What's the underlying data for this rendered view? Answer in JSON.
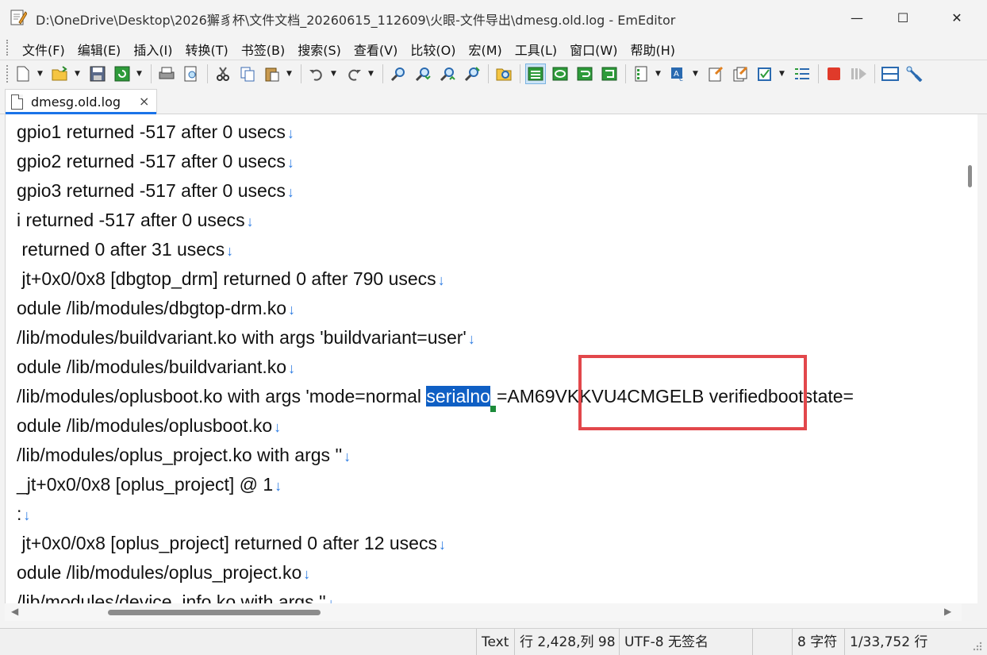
{
  "window": {
    "title": "D:\\OneDrive\\Desktop\\2026獬豸杯\\文件文档_20260615_112609\\火眼-文件导出\\dmesg.old.log - EmEditor",
    "min_glyph": "—",
    "max_glyph": "☐",
    "close_glyph": "✕"
  },
  "menu": {
    "items": [
      "文件(F)",
      "编辑(E)",
      "插入(I)",
      "转换(T)",
      "书签(B)",
      "搜索(S)",
      "查看(V)",
      "比较(O)",
      "宏(M)",
      "工具(L)",
      "窗口(W)",
      "帮助(H)"
    ]
  },
  "toolbar": {
    "icons": [
      "new-icon",
      "open-icon",
      "save-icon",
      "reload-icon",
      "print-icon",
      "print-preview-icon",
      "cut-icon",
      "copy-icon",
      "paste-icon",
      "undo-icon",
      "redo-icon",
      "find-icon",
      "find-next-icon",
      "find-prev-icon",
      "replace-icon",
      "find-in-files-icon",
      "wrap-icon",
      "wrap-window-icon",
      "wrap-page-icon",
      "wrap-char-icon",
      "property-icon",
      "encoding-icon",
      "outline-icon",
      "clipboard-icon",
      "checkbox-icon",
      "list-icon",
      "stop-icon",
      "play-icon",
      "split-icon",
      "tools-icon"
    ]
  },
  "tab": {
    "label": "dmesg.old.log",
    "close_glyph": "×"
  },
  "editor": {
    "eol_glyph": "↓",
    "lines": [
      "gpio1 returned -517 after 0 usecs",
      "gpio2 returned -517 after 0 usecs",
      "gpio3 returned -517 after 0 usecs",
      "i returned -517 after 0 usecs",
      " returned 0 after 31 usecs",
      " jt+0x0/0x8 [dbgtop_drm] returned 0 after 790 usecs",
      "odule /lib/modules/dbgtop-drm.ko",
      "/lib/modules/buildvariant.ko with args 'buildvariant=user'",
      "odule /lib/modules/buildvariant.ko",
      "",
      "odule /lib/modules/oplusboot.ko",
      "/lib/modules/oplus_project.ko with args ''",
      "_jt+0x0/0x8 [oplus_project] @ 1",
      ":",
      " jt+0x0/0x8 [oplus_project] returned 0 after 12 usecs",
      "odule /lib/modules/oplus_project.ko",
      "/lib/modules/device_info.ko with args ''"
    ],
    "highlight_line": {
      "prefix": "/lib/modules/oplusboot.ko with args 'mode=normal ",
      "selected": "serialno",
      "suffix": "=AM69VKKVU4CMGELB verifiedbootstate="
    }
  },
  "statusbar": {
    "mode": "Text",
    "position": "行 2,428,列 98",
    "encoding": "UTF-8 无签名",
    "selection": "8 字符",
    "line_count": "1/33,752 行"
  }
}
